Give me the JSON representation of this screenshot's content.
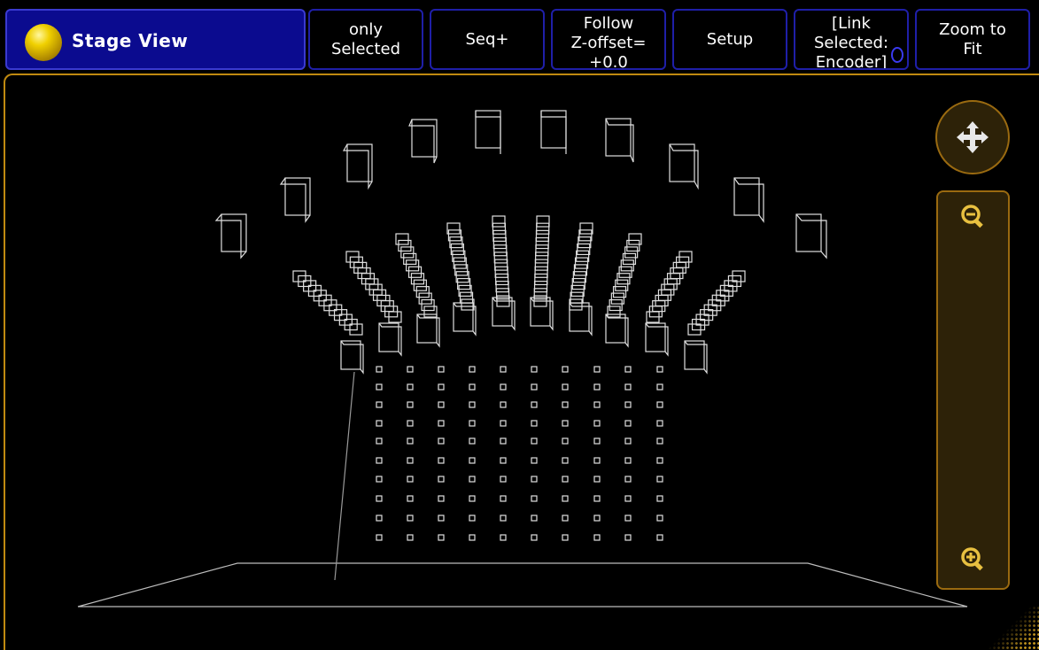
{
  "window": {
    "title": "Stage View",
    "title_icon": "yellow-orb-icon"
  },
  "toolbar": {
    "buttons": [
      {
        "id": "only-selected",
        "label": "only\nSelected"
      },
      {
        "id": "seq-plus",
        "label": "Seq+"
      },
      {
        "id": "follow-z-offset",
        "label": "Follow\nZ-offset=\n+0.0"
      },
      {
        "id": "setup",
        "label": "Setup"
      },
      {
        "id": "link-selected",
        "label": "[Link\nSelected:\nEncoder]"
      },
      {
        "id": "zoom-to-fit",
        "label": "Zoom to\nFit"
      }
    ]
  },
  "navigation": {
    "move_icon": "four-arrows-move-icon",
    "zoom_out_icon": "zoom-out-icon",
    "zoom_in_icon": "zoom-in-icon"
  },
  "colors": {
    "accent": "#c08a10",
    "title_bg": "#0b0b8f",
    "button_border": "#1f1fa8",
    "fixture_stroke": "#e0e0e0"
  }
}
